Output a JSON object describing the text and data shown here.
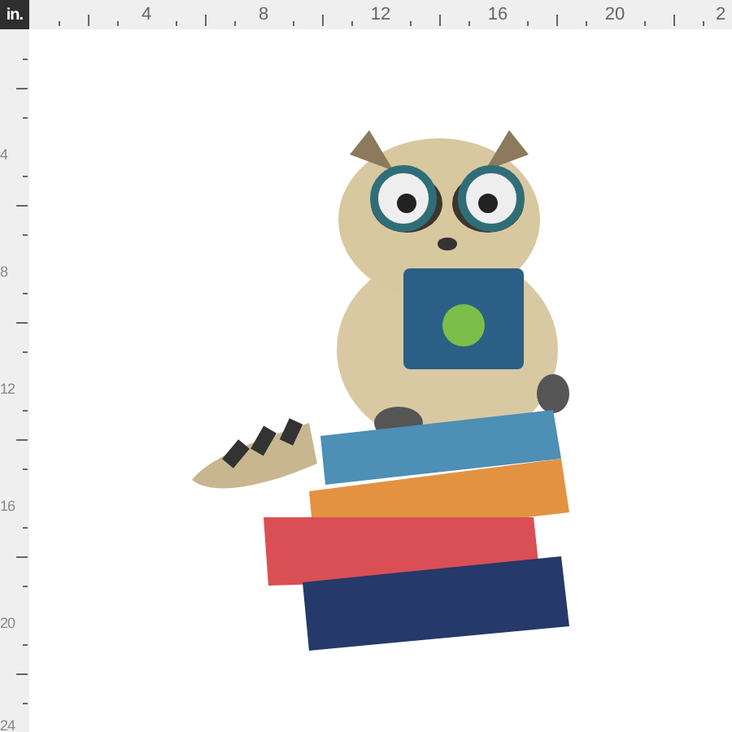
{
  "ruler_unit": "in.",
  "top_ruler": {
    "labels": [
      "4",
      "8",
      "12",
      "16",
      "20",
      "2"
    ]
  },
  "left_ruler": {
    "labels": [
      "4",
      "8",
      "12",
      "16",
      "20",
      "24"
    ]
  }
}
